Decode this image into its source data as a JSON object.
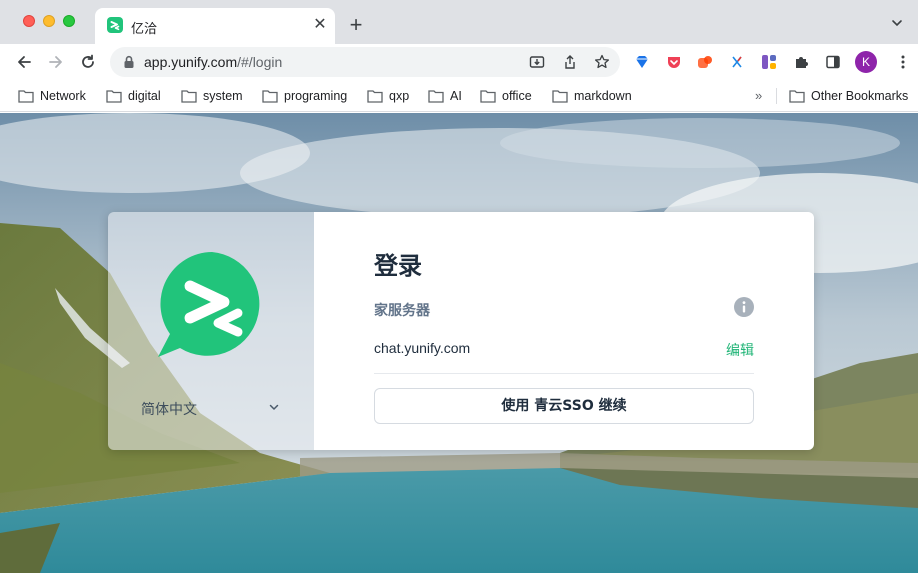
{
  "browser": {
    "tab": {
      "title": "亿洽"
    },
    "address_bar": {
      "url_host": "app.yunify.com",
      "url_rest": "/#/login"
    },
    "avatar_initial": "K",
    "bookmarks": [
      {
        "label": "Network"
      },
      {
        "label": "digital"
      },
      {
        "label": "system"
      },
      {
        "label": "programing"
      },
      {
        "label": "qxp"
      },
      {
        "label": "AI"
      },
      {
        "label": "office"
      },
      {
        "label": "markdown"
      }
    ],
    "bookmarks_overflow": "»",
    "other_bookmarks": "Other Bookmarks"
  },
  "login": {
    "title": "登录",
    "server_label": "家服务器",
    "server_host": "chat.yunify.com",
    "edit_label": "编辑",
    "sso_button": "使用 青云SSO 继续",
    "language": "简体中文"
  },
  "colors": {
    "brand_green": "#21c47b",
    "link_green": "#21b577",
    "text_dark": "#1f2d3d",
    "text_muted": "#62748a"
  }
}
